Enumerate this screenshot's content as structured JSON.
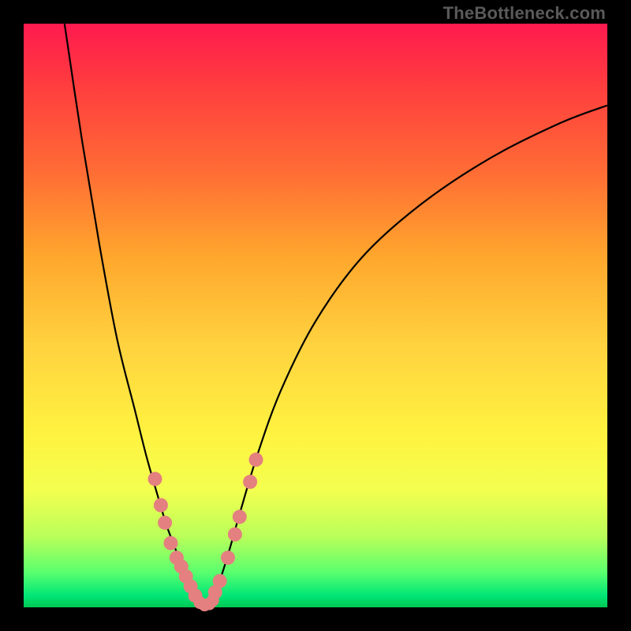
{
  "watermark": "TheBottleneck.com",
  "colors": {
    "background": "#000000",
    "gradient_top": "#ff1a4f",
    "gradient_bottom": "#00c853",
    "curve": "#000000",
    "dot": "#e48080"
  },
  "chart_data": {
    "type": "line",
    "title": "",
    "xlabel": "",
    "ylabel": "",
    "xlim": [
      0,
      100
    ],
    "ylim": [
      0,
      100
    ],
    "series": [
      {
        "name": "left-curve",
        "x": [
          7,
          10,
          13,
          16,
          19,
          21,
          23,
          24.5,
          26,
          27,
          28,
          29,
          30,
          31
        ],
        "values": [
          100,
          80,
          62,
          46,
          34,
          26,
          19,
          14,
          10,
          7,
          4.5,
          2.5,
          1,
          0.2
        ]
      },
      {
        "name": "right-curve",
        "x": [
          31,
          33,
          35,
          37,
          40,
          44,
          50,
          58,
          68,
          80,
          92,
          100
        ],
        "values": [
          0.2,
          3,
          9,
          16,
          26,
          37,
          49,
          60,
          69,
          77,
          83,
          86
        ]
      }
    ],
    "dots_left": [
      {
        "x": 22.5,
        "y": 22
      },
      {
        "x": 23.5,
        "y": 17.5
      },
      {
        "x": 24.2,
        "y": 14.5
      },
      {
        "x": 25.2,
        "y": 11
      },
      {
        "x": 26.2,
        "y": 8.5
      },
      {
        "x": 27.0,
        "y": 7
      },
      {
        "x": 27.8,
        "y": 5.3
      },
      {
        "x": 28.6,
        "y": 3.6
      },
      {
        "x": 29.4,
        "y": 2.0
      }
    ],
    "dots_right": [
      {
        "x": 32.8,
        "y": 2.6
      },
      {
        "x": 33.6,
        "y": 4.5
      },
      {
        "x": 35.0,
        "y": 8.5
      },
      {
        "x": 36.2,
        "y": 12.5
      },
      {
        "x": 37.0,
        "y": 15.5
      },
      {
        "x": 38.8,
        "y": 21.5
      },
      {
        "x": 39.8,
        "y": 25.3
      }
    ],
    "dots_bottom": [
      {
        "x": 30.2,
        "y": 0.8
      },
      {
        "x": 31.0,
        "y": 0.4
      },
      {
        "x": 31.8,
        "y": 0.6
      },
      {
        "x": 32.4,
        "y": 1.2
      }
    ]
  }
}
